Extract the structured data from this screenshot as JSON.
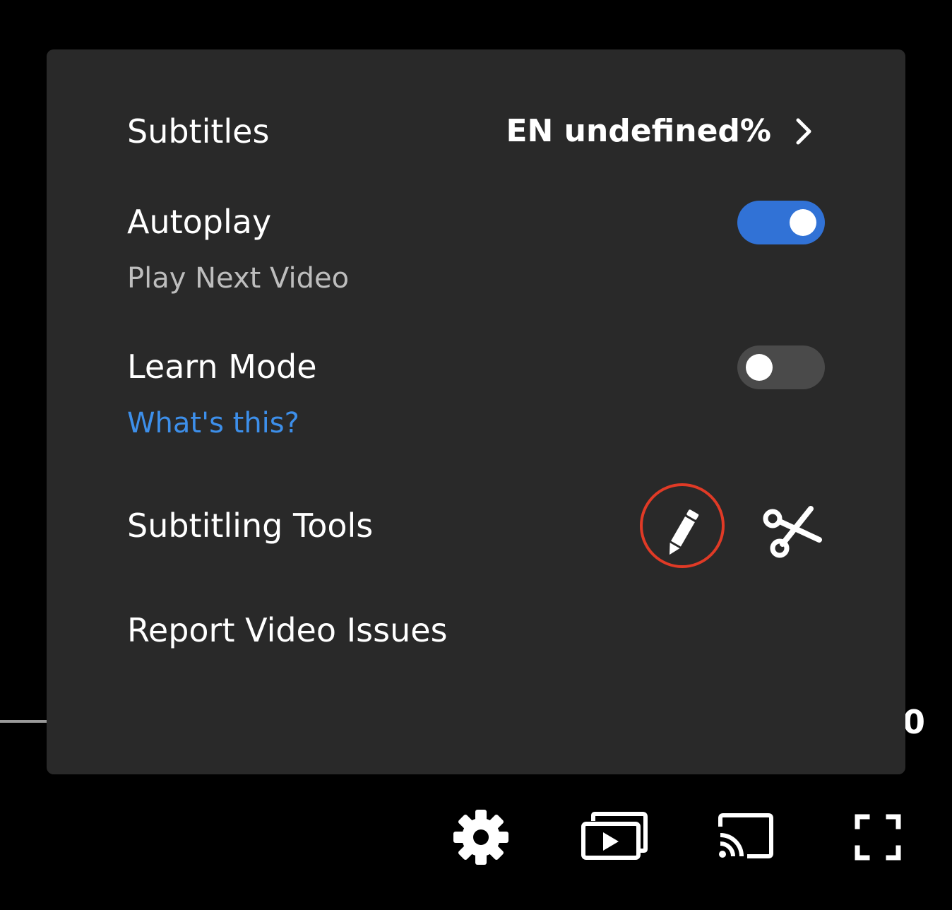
{
  "menu": {
    "subtitles": {
      "label": "Subtitles",
      "value": "EN undefined%",
      "icon": "chevron-right-icon"
    },
    "autoplay": {
      "label": "Autoplay",
      "description": "Play Next Video",
      "enabled": true
    },
    "learn_mode": {
      "label": "Learn Mode",
      "link": "What's this?",
      "enabled": false
    },
    "subtitling_tools": {
      "label": "Subtitling Tools",
      "tools": [
        {
          "icon": "pencil-icon",
          "highlighted": true
        },
        {
          "icon": "scissors-icon",
          "highlighted": false
        }
      ]
    },
    "report": {
      "label": "Report Video Issues"
    }
  },
  "player": {
    "time_fragment": "0",
    "controls": [
      "gear-icon",
      "picture-in-picture-icon",
      "cast-icon",
      "fullscreen-icon"
    ]
  },
  "colors": {
    "panel_bg": "#292929",
    "toggle_on": "#3172d6",
    "toggle_off": "#4a4a4a",
    "link": "#3d8fea",
    "highlight_ring": "#e03a26",
    "text": "#ffffff",
    "subtext": "#bdbdbd"
  }
}
